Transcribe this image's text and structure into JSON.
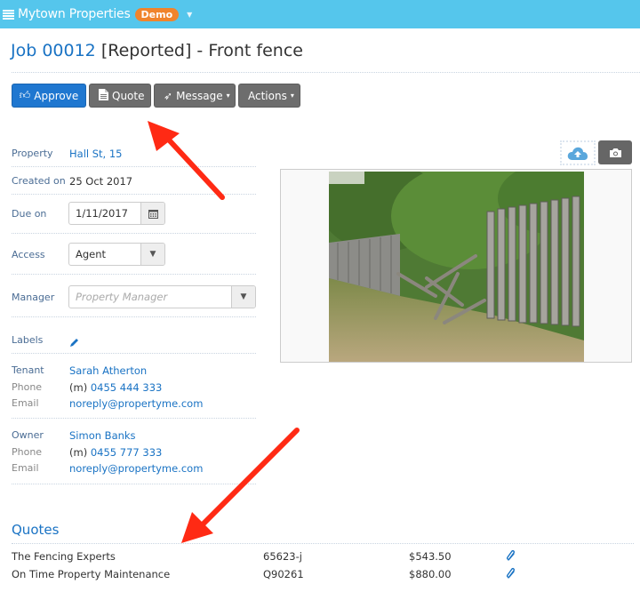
{
  "topbar": {
    "menu_icon": "list-icon",
    "app_title": "Mytown Properties",
    "badge": "Demo",
    "caret": "▼",
    "bg_color": "#55c6ec",
    "badge_color": "#f0842c"
  },
  "header": {
    "job_number": "Job 00012",
    "rest": " [Reported] - Front fence"
  },
  "toolbar": {
    "approve": {
      "label": "Approve",
      "icon": "thumbs-up-icon"
    },
    "quote": {
      "label": "Quote",
      "icon": "document-icon"
    },
    "message": {
      "label": "Message",
      "icon": "paper-plane-icon"
    },
    "actions": {
      "label": "Actions"
    },
    "caret": "▾"
  },
  "details": {
    "property": {
      "label": "Property",
      "value": "Hall St, 15"
    },
    "created": {
      "label": "Created on",
      "value": "25 Oct 2017"
    },
    "due": {
      "label": "Due on",
      "value": "1/11/2017"
    },
    "access": {
      "label": "Access",
      "value": "Agent"
    },
    "manager": {
      "label": "Manager",
      "placeholder": "Property Manager"
    },
    "labels": {
      "label": "Labels"
    }
  },
  "tenant": {
    "label": "Tenant",
    "name": "Sarah Atherton",
    "phone_label": "Phone",
    "phone_prefix": "(m)",
    "phone": "0455 444 333",
    "email_label": "Email",
    "email": "noreply@propertyme.com"
  },
  "owner": {
    "label": "Owner",
    "name": "Simon Banks",
    "phone_label": "Phone",
    "phone_prefix": "(m)",
    "phone": "0455 777 333",
    "email_label": "Email",
    "email": "noreply@propertyme.com"
  },
  "quotes": {
    "title": "Quotes",
    "rows": [
      {
        "supplier": "The Fencing Experts",
        "ref": "65623-j",
        "amount": "$543.50"
      },
      {
        "supplier": "On Time Property Maintenance",
        "ref": "Q90261",
        "amount": "$880.00"
      }
    ]
  },
  "annotation_color": "#ff2a14"
}
